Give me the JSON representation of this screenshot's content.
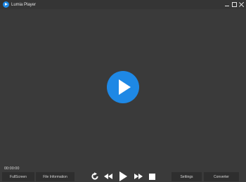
{
  "window": {
    "title": "Lumia Player",
    "logo_icon": "play-circle-icon",
    "controls": [
      "minimize-icon",
      "maximize-icon",
      "close-icon"
    ]
  },
  "player": {
    "center_icon": "play-icon",
    "time": "00:00:00",
    "accent_color": "#1e88e5"
  },
  "footer": {
    "fullscreen_label": "FullScreen",
    "file_info_label": "File Information",
    "settings_label": "Settings",
    "converter_label": "Converter"
  },
  "transport": [
    "reload-icon",
    "rewind-icon",
    "play-icon",
    "fast-forward-icon",
    "stop-icon"
  ]
}
